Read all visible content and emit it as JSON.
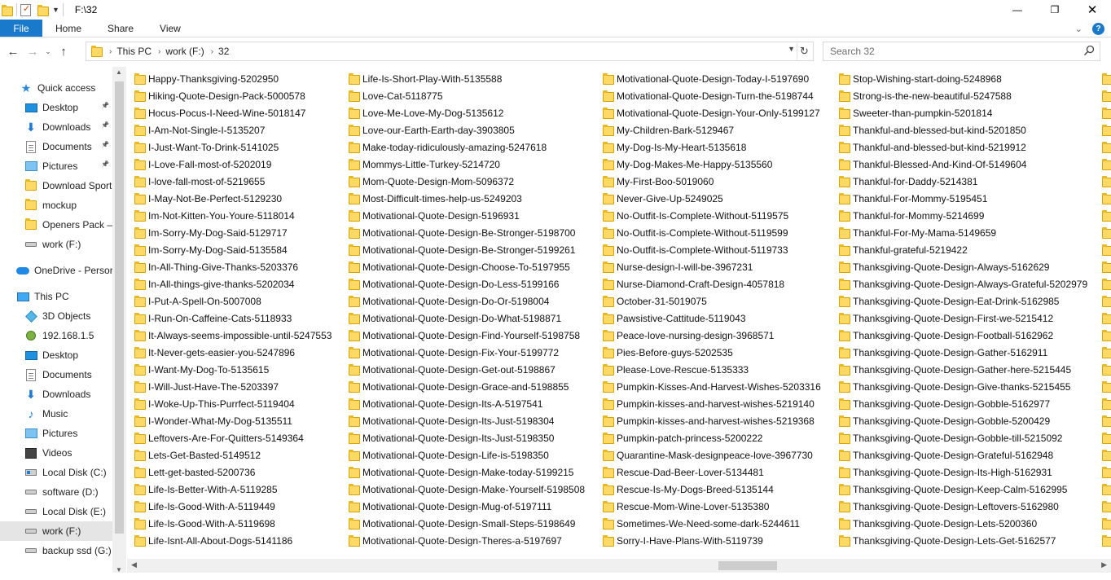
{
  "window": {
    "title": "F:\\32",
    "controls": [
      "—",
      "❐",
      "✕"
    ]
  },
  "ribbon": {
    "tabs": [
      "File",
      "Home",
      "Share",
      "View"
    ]
  },
  "address": {
    "crumbs": [
      "This PC",
      "work (F:)",
      "32"
    ]
  },
  "search": {
    "placeholder": "Search 32"
  },
  "nav": {
    "items": [
      {
        "label": "Quick access",
        "icon": "star-icon",
        "pinned": false
      },
      {
        "label": "Desktop",
        "icon": "desktop-icon",
        "pinned": true
      },
      {
        "label": "Downloads",
        "icon": "downloads-icon",
        "pinned": true
      },
      {
        "label": "Documents",
        "icon": "documents-icon",
        "pinned": true
      },
      {
        "label": "Pictures",
        "icon": "pictures-icon",
        "pinned": true
      },
      {
        "label": "Download Sport",
        "icon": "folder-icon",
        "pinned": false
      },
      {
        "label": "mockup",
        "icon": "folder-icon",
        "pinned": false
      },
      {
        "label": "Openers Pack – \\",
        "icon": "folder-icon",
        "pinned": false
      },
      {
        "label": "work (F:)",
        "icon": "drive-icon",
        "pinned": false
      },
      {
        "label": "OneDrive - Persor",
        "icon": "onedrive-icon",
        "pinned": false
      },
      {
        "label": "This PC",
        "icon": "this-pc-icon",
        "pinned": false
      },
      {
        "label": "3D Objects",
        "icon": "3d-objects-icon",
        "pinned": false
      },
      {
        "label": "192.168.1.5",
        "icon": "network-location-icon",
        "pinned": false
      },
      {
        "label": "Desktop",
        "icon": "desktop-icon",
        "pinned": false
      },
      {
        "label": "Documents",
        "icon": "documents-icon",
        "pinned": false
      },
      {
        "label": "Downloads",
        "icon": "downloads-icon",
        "pinned": false
      },
      {
        "label": "Music",
        "icon": "music-icon",
        "pinned": false
      },
      {
        "label": "Pictures",
        "icon": "pictures-icon",
        "pinned": false
      },
      {
        "label": "Videos",
        "icon": "videos-icon",
        "pinned": false
      },
      {
        "label": "Local Disk (C:)",
        "icon": "windows-drive-icon",
        "pinned": false
      },
      {
        "label": "software (D:)",
        "icon": "drive-icon",
        "pinned": false
      },
      {
        "label": "Local Disk (E:)",
        "icon": "drive-icon",
        "pinned": false
      },
      {
        "label": "work (F:)",
        "icon": "drive-icon",
        "pinned": false,
        "selected": true
      },
      {
        "label": "backup ssd (G:)",
        "icon": "drive-icon",
        "pinned": false
      }
    ]
  },
  "files": {
    "columns": [
      [
        "Happy-Thanksgiving-5202950",
        "Hiking-Quote-Design-Pack-5000578",
        "Hocus-Pocus-I-Need-Wine-5018147",
        "I-Am-Not-Single-I-5135207",
        "I-Just-Want-To-Drink-5141025",
        "I-Love-Fall-most-of-5202019",
        "I-love-fall-most-of-5219655",
        "I-May-Not-Be-Perfect-5129230",
        "Im-Not-Kitten-You-Youre-5118014",
        "Im-Sorry-My-Dog-Said-5129717",
        "Im-Sorry-My-Dog-Said-5135584",
        "In-All-Thing-Give-Thanks-5203376",
        "In-All-things-give-thanks-5202034",
        "I-Put-A-Spell-On-5007008",
        "I-Run-On-Caffeine-Cats-5118933",
        "It-Always-seems-impossible-until-5247553",
        "It-Never-gets-easier-you-5247896",
        "I-Want-My-Dog-To-5135615",
        "I-Will-Just-Have-The-5203397",
        "I-Woke-Up-This-Purrfect-5119404",
        "I-Wonder-What-My-Dog-5135511",
        "Leftovers-Are-For-Quitters-5149364",
        "Lets-Get-Basted-5149512",
        "Lett-get-basted-5200736",
        "Life-Is-Better-With-A-5119285",
        "Life-Is-Good-With-A-5119449",
        "Life-Is-Good-With-A-5119698",
        "Life-Isnt-All-About-Dogs-5141186"
      ],
      [
        "Life-Is-Short-Play-With-5135588",
        "Love-Cat-5118775",
        "Love-Me-Love-My-Dog-5135612",
        "Love-our-Earth-Earth-day-3903805",
        "Make-today-ridiculously-amazing-5247618",
        "Mommys-Little-Turkey-5214720",
        "Mom-Quote-Design-Mom-5096372",
        "Most-Difficult-times-help-us-5249203",
        "Motivational-Quote-Design-5196931",
        "Motivational-Quote-Design-Be-Stronger-5198700",
        "Motivational-Quote-Design-Be-Stronger-5199261",
        "Motivational-Quote-Design-Choose-To-5197955",
        "Motivational-Quote-Design-Do-Less-5199166",
        "Motivational-Quote-Design-Do-Or-5198004",
        "Motivational-Quote-Design-Do-What-5198871",
        "Motivational-Quote-Design-Find-Yourself-5198758",
        "Motivational-Quote-Design-Fix-Your-5199772",
        "Motivational-Quote-Design-Get-out-5198867",
        "Motivational-Quote-Design-Grace-and-5198855",
        "Motivational-Quote-Design-Its-A-5197541",
        "Motivational-Quote-Design-Its-Just-5198304",
        "Motivational-Quote-Design-Its-Just-5198350",
        "Motivational-Quote-Design-Life-is-5198350",
        "Motivational-Quote-Design-Make-today-5199215",
        "Motivational-Quote-Design-Make-Yourself-5198508",
        "Motivational-Quote-Design-Mug-of-5197111",
        "Motivational-Quote-Design-Small-Steps-5198649",
        "Motivational-Quote-Design-Theres-a-5197697"
      ],
      [
        "Motivational-Quote-Design-Today-I-5197690",
        "Motivational-Quote-Design-Turn-the-5198744",
        "Motivational-Quote-Design-Your-Only-5199127",
        "My-Children-Bark-5129467",
        "My-Dog-Is-My-Heart-5135618",
        "My-Dog-Makes-Me-Happy-5135560",
        "My-First-Boo-5019060",
        "Never-Give-Up-5249025",
        "No-Outfit-Is-Complete-Without-5119575",
        "No-Outfit-is-Complete-Without-5119599",
        "No-Outfit-is-Complete-Without-5119733",
        "Nurse-design-I-will-be-3967231",
        "Nurse-Diamond-Craft-Design-4057818",
        "October-31-5019075",
        "Pawsistive-Cattitude-5119043",
        "Peace-love-nursing-design-3968571",
        "Pies-Before-guys-5202535",
        "Please-Love-Rescue-5135333",
        "Pumpkin-Kisses-And-Harvest-Wishes-5203316",
        "Pumpkin-kisses-and-harvest-wishes-5219140",
        "Pumpkin-kisses-and-harvest-wishes-5219368",
        "Pumpkin-patch-princess-5200222",
        "Quarantine-Mask-designpeace-love-3967730",
        "Rescue-Dad-Beer-Lover-5134481",
        "Rescue-Is-My-Dogs-Breed-5135144",
        "Rescue-Mom-Wine-Lover-5135380",
        "Sometimes-We-Need-some-dark-5244611",
        "Sorry-I-Have-Plans-With-5119739"
      ],
      [
        "Stop-Wishing-start-doing-5248968",
        "Strong-is-the-new-beautiful-5247588",
        "Sweeter-than-pumpkin-5201814",
        "Thankful-and-blessed-but-kind-5201850",
        "Thankful-and-blessed-but-kind-5219912",
        "Thankful-Blessed-And-Kind-Of-5149604",
        "Thankful-for-Daddy-5214381",
        "Thankful-For-Mommy-5195451",
        "Thankful-for-Mommy-5214699",
        "Thankful-For-My-Mama-5149659",
        "Thankful-grateful-5219422",
        "Thanksgiving-Quote-Design-Always-5162629",
        "Thanksgiving-Quote-Design-Always-Grateful-5202979",
        "Thanksgiving-Quote-Design-Eat-Drink-5162985",
        "Thanksgiving-Quote-Design-First-we-5215412",
        "Thanksgiving-Quote-Design-Football-5162962",
        "Thanksgiving-Quote-Design-Gather-5162911",
        "Thanksgiving-Quote-Design-Gather-here-5215445",
        "Thanksgiving-Quote-Design-Give-thanks-5215455",
        "Thanksgiving-Quote-Design-Gobble-5162977",
        "Thanksgiving-Quote-Design-Gobble-5200429",
        "Thanksgiving-Quote-Design-Gobble-till-5215092",
        "Thanksgiving-Quote-Design-Grateful-5162948",
        "Thanksgiving-Quote-Design-Its-High-5162931",
        "Thanksgiving-Quote-Design-Keep-Calm-5162995",
        "Thanksgiving-Quote-Design-Leftovers-5162980",
        "Thanksgiving-Quote-Design-Lets-5200360",
        "Thanksgiving-Quote-Design-Lets-Get-5162577"
      ]
    ]
  }
}
